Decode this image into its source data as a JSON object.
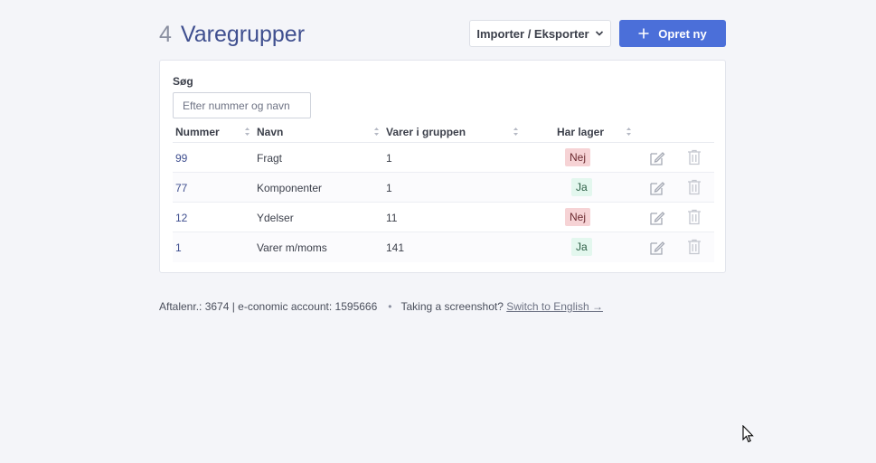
{
  "header": {
    "count": "4",
    "title": "Varegrupper",
    "export_label": "Importer / Eksporter",
    "create_label": "Opret ny"
  },
  "search": {
    "label": "Søg",
    "placeholder": "Efter nummer og navn",
    "value": ""
  },
  "table": {
    "columns": [
      "Nummer",
      "Navn",
      "Varer i gruppen",
      "Har lager"
    ],
    "rows": [
      {
        "nummer": "99",
        "navn": "Fragt",
        "varer": "1",
        "lager": "Nej"
      },
      {
        "nummer": "77",
        "navn": "Komponenter",
        "varer": "1",
        "lager": "Ja"
      },
      {
        "nummer": "12",
        "navn": "Ydelser",
        "varer": "11",
        "lager": "Nej"
      },
      {
        "nummer": "1",
        "navn": "Varer m/moms",
        "varer": "141",
        "lager": "Ja"
      }
    ]
  },
  "footer": {
    "account_text": "Aftalenr.: 3674 | e-conomic account: 1595666",
    "separator": "•",
    "screenshot_text": "Taking a screenshot?",
    "switch_link": "Switch to English →"
  },
  "colors": {
    "primary": "#4b6fd9",
    "title": "#3f4f8f",
    "badge_no_bg": "#f6d3d5",
    "badge_yes_bg": "#e3f7ee",
    "background": "#f4f5f9"
  },
  "icons": {
    "export_chevron": "chevron-down-icon",
    "create_plus": "plus-icon",
    "sort": "sort-icon",
    "edit": "edit-icon",
    "delete": "trash-icon"
  }
}
